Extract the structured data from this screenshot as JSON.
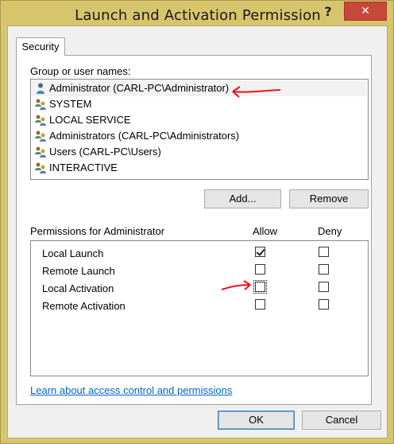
{
  "window": {
    "title": "Launch and Activation Permission",
    "help_glyph": "?",
    "close_glyph": "✕"
  },
  "tabs": [
    {
      "label": "Security"
    }
  ],
  "groups": {
    "label": "Group or user names:",
    "items": [
      {
        "name": "Administrator (CARL-PC\\Administrator)",
        "icon": "single-user-icon",
        "selected": true
      },
      {
        "name": "SYSTEM",
        "icon": "user-group-icon"
      },
      {
        "name": "LOCAL SERVICE",
        "icon": "user-group-icon"
      },
      {
        "name": "Administrators (CARL-PC\\Administrators)",
        "icon": "user-group-icon"
      },
      {
        "name": "Users (CARL-PC\\Users)",
        "icon": "user-group-icon"
      },
      {
        "name": "INTERACTIVE",
        "icon": "user-group-icon"
      }
    ]
  },
  "buttons": {
    "add": "Add...",
    "remove": "Remove",
    "ok": "OK",
    "cancel": "Cancel"
  },
  "permissions": {
    "label": "Permissions for Administrator",
    "allow_header": "Allow",
    "deny_header": "Deny",
    "rows": [
      {
        "name": "Local Launch",
        "allow": true,
        "deny": false
      },
      {
        "name": "Remote Launch",
        "allow": false,
        "deny": false
      },
      {
        "name": "Local Activation",
        "allow": false,
        "deny": false
      },
      {
        "name": "Remote Activation",
        "allow": false,
        "deny": false
      }
    ]
  },
  "help_link": "Learn about access control and permissions",
  "annotation_color": "#e8141c"
}
